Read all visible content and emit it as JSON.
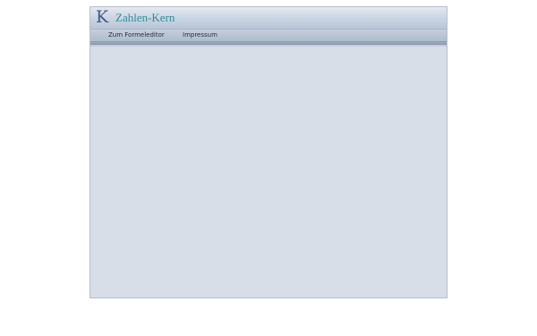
{
  "header": {
    "logo_letter": "K",
    "site_title": "Zahlen-Kern"
  },
  "nav": {
    "items": [
      {
        "label": "Zum Formeleditor"
      },
      {
        "label": "Impressum"
      }
    ]
  },
  "colors": {
    "title_teal": "#2f8f97",
    "logo_blue": "#3f5a86",
    "content_bg": "#d8dee8"
  }
}
